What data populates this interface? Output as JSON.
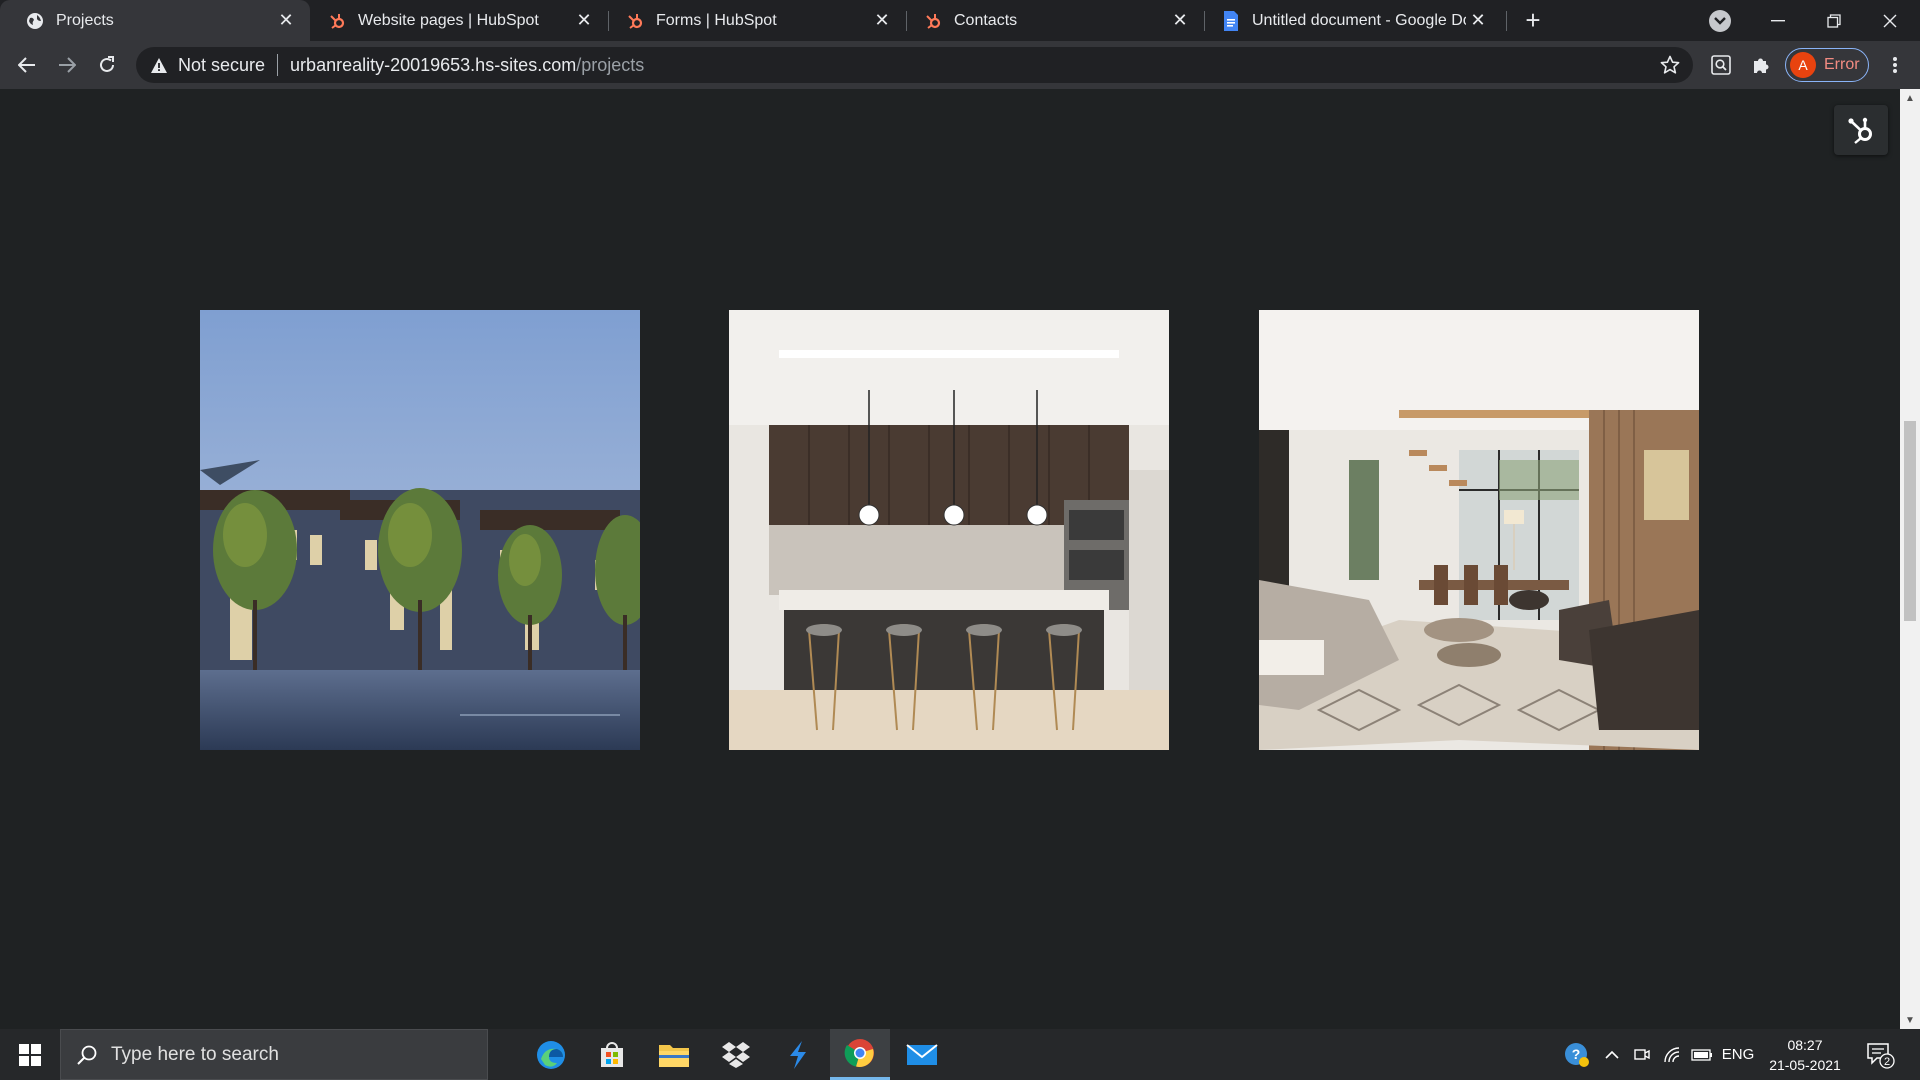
{
  "tabs": [
    {
      "title": "Projects",
      "favicon": "globe-icon",
      "active": true
    },
    {
      "title": "Website pages | HubSpot",
      "favicon": "hubspot-icon",
      "active": false
    },
    {
      "title": "Forms | HubSpot",
      "favicon": "hubspot-icon",
      "active": false
    },
    {
      "title": "Contacts",
      "favicon": "hubspot-icon",
      "active": false
    },
    {
      "title": "Untitled document - Google Docs",
      "favicon": "google-docs-icon",
      "active": false
    }
  ],
  "address": {
    "security": "Not secure",
    "host": "urbanreality-20019653.hs-sites.com",
    "path": "/projects"
  },
  "profile": {
    "initial": "A",
    "status": "Error"
  },
  "gallery": [
    {
      "subject": "townhouse-exterior"
    },
    {
      "subject": "kitchen-interior"
    },
    {
      "subject": "living-room-interior"
    }
  ],
  "taskbar": {
    "search_placeholder": "Type here to search",
    "language": "ENG",
    "time": "08:27",
    "date": "21-05-2021",
    "notifications": "2"
  },
  "colors": {
    "page_bg": "#1f2223",
    "hubspot_orange": "#ff7a59",
    "docs_blue": "#4285f4"
  }
}
